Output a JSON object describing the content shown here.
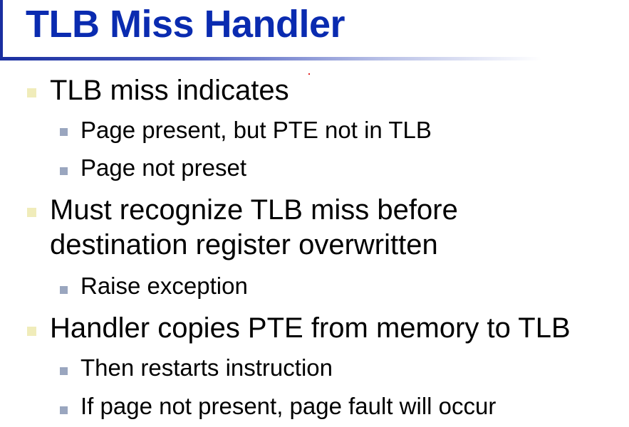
{
  "slide": {
    "title": "TLB Miss Handler",
    "bullets": [
      {
        "text": "TLB miss indicates",
        "subitems": [
          "Page present, but PTE not in TLB",
          "Page not preset"
        ]
      },
      {
        "text_line1": "Must recognize TLB miss before",
        "text_line2": "destination register overwritten",
        "subitems": [
          "Raise exception"
        ]
      },
      {
        "text": "Handler copies PTE from memory to TLB",
        "subitems": [
          "Then restarts instruction",
          "If page not present, page fault will occur"
        ]
      }
    ]
  },
  "colors": {
    "title": "#0a2bb0",
    "accent_rule": "#1a2fa0",
    "level1_bullet": "#f0ecba",
    "level2_bullet": "#9aa6bf"
  },
  "icons": {
    "level1_bullet": "square-bullet-icon",
    "level2_bullet": "small-square-bullet-icon"
  }
}
